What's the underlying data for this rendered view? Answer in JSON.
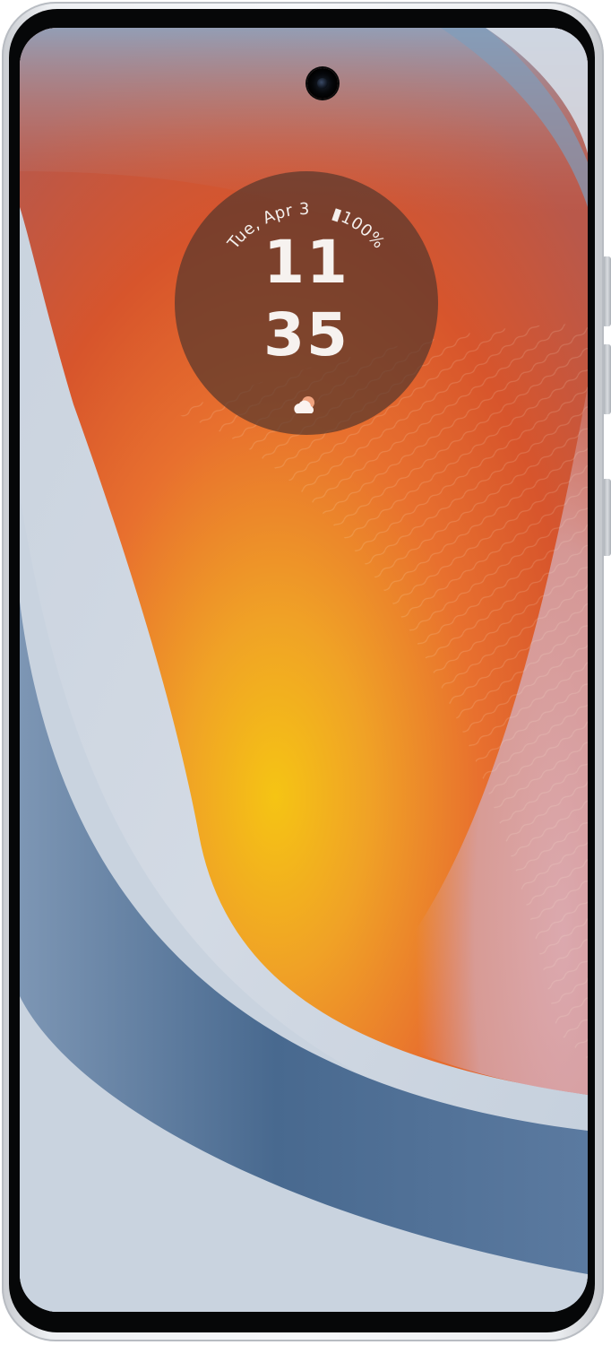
{
  "lock_screen": {
    "date": "Tue, Apr 3",
    "battery": "100%",
    "time": {
      "hour": "11",
      "minute": "35"
    },
    "weather_icon": "partly-cloudy-icon",
    "battery_icon": "battery-icon"
  },
  "colors": {
    "widget_background": "#58382c",
    "clock_text": "#f6f2ef",
    "wallpaper_orange": "#e2612e",
    "wallpaper_yellow": "#f2c21a",
    "wallpaper_blue": "#4a6a8e",
    "wallpaper_pink": "#d9b3bf"
  }
}
